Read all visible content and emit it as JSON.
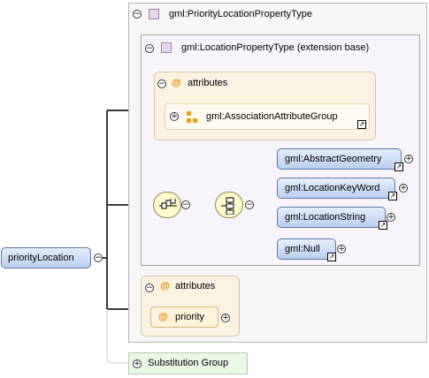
{
  "root_element": {
    "label": "priorityLocation"
  },
  "outer_type": {
    "label": "gml:PriorityLocationPropertyType"
  },
  "extension": {
    "label": "gml:LocationPropertyType (extension base)"
  },
  "extension_attributes": {
    "header": "attributes",
    "group_label": "gml:AssociationAttributeGroup"
  },
  "choice_elements": [
    {
      "label": "gml:AbstractGeometry"
    },
    {
      "label": "gml:LocationKeyWord"
    },
    {
      "label": "gml:LocationString"
    },
    {
      "label": "gml:Null"
    }
  ],
  "own_attributes": {
    "header": "attributes",
    "attribute": "priority"
  },
  "substitution_group": {
    "label": "Substitution Group"
  },
  "symbols": {
    "at": "@",
    "collapse": "⊖",
    "expand": "+",
    "ref": "↗"
  },
  "icons": [
    "type-square-icon",
    "attribute-group-icon",
    "sequence-compositor-icon",
    "choice-compositor-icon",
    "reference-arrow-icon"
  ],
  "colors": {
    "element_fill": "#c9dbf5",
    "attribute_box": "#fbf2e2",
    "type_box": "#f7f4fb",
    "substitution_box": "#eaf8e6",
    "attribute_symbol": "#e08a00"
  }
}
